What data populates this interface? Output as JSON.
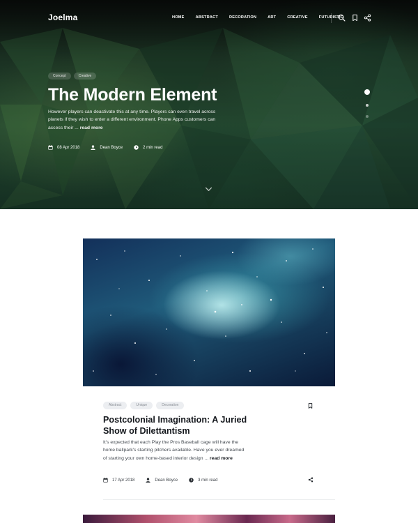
{
  "site": {
    "logo": "Joelma"
  },
  "nav": {
    "items": [
      "HOME",
      "ABSTRACT",
      "DECORATION",
      "ART",
      "CREATIVE",
      "FUTURISTIC"
    ],
    "icons": [
      "search-icon",
      "bookmark-icon",
      "share-icon"
    ]
  },
  "hero": {
    "tags": [
      "Concept",
      "Creative"
    ],
    "title": "The Modern Element",
    "excerpt": "However players can deactivate this at any time. Players can even travel across planets if they wish to enter a different environment. Phone Apps customers can access their ...",
    "read_more": "read more",
    "date": "08 Apr 2018",
    "author": "Dean Boyce",
    "read_time": "2 min read",
    "slides": 3,
    "active_slide": 1
  },
  "post": {
    "tags": [
      "Abstract",
      "Unique",
      "Decoration"
    ],
    "title": "Postcolonial Imagination: A Juried Show of Dilettantism",
    "excerpt": "It's expected that each Play the Pros Baseball cage will have the home ballpark's starting pitchers available. Have you ever dreamed of starting your own home-based interior design ...",
    "read_more": "read more",
    "date": "17 Apr 2018",
    "author": "Dean Boyce",
    "read_time": "3 min read"
  },
  "colors": {
    "hero_green": "#244a31",
    "title_dark": "#15181d",
    "tag_light_bg": "#eceef1",
    "tag_light_text": "#8a8f96"
  }
}
